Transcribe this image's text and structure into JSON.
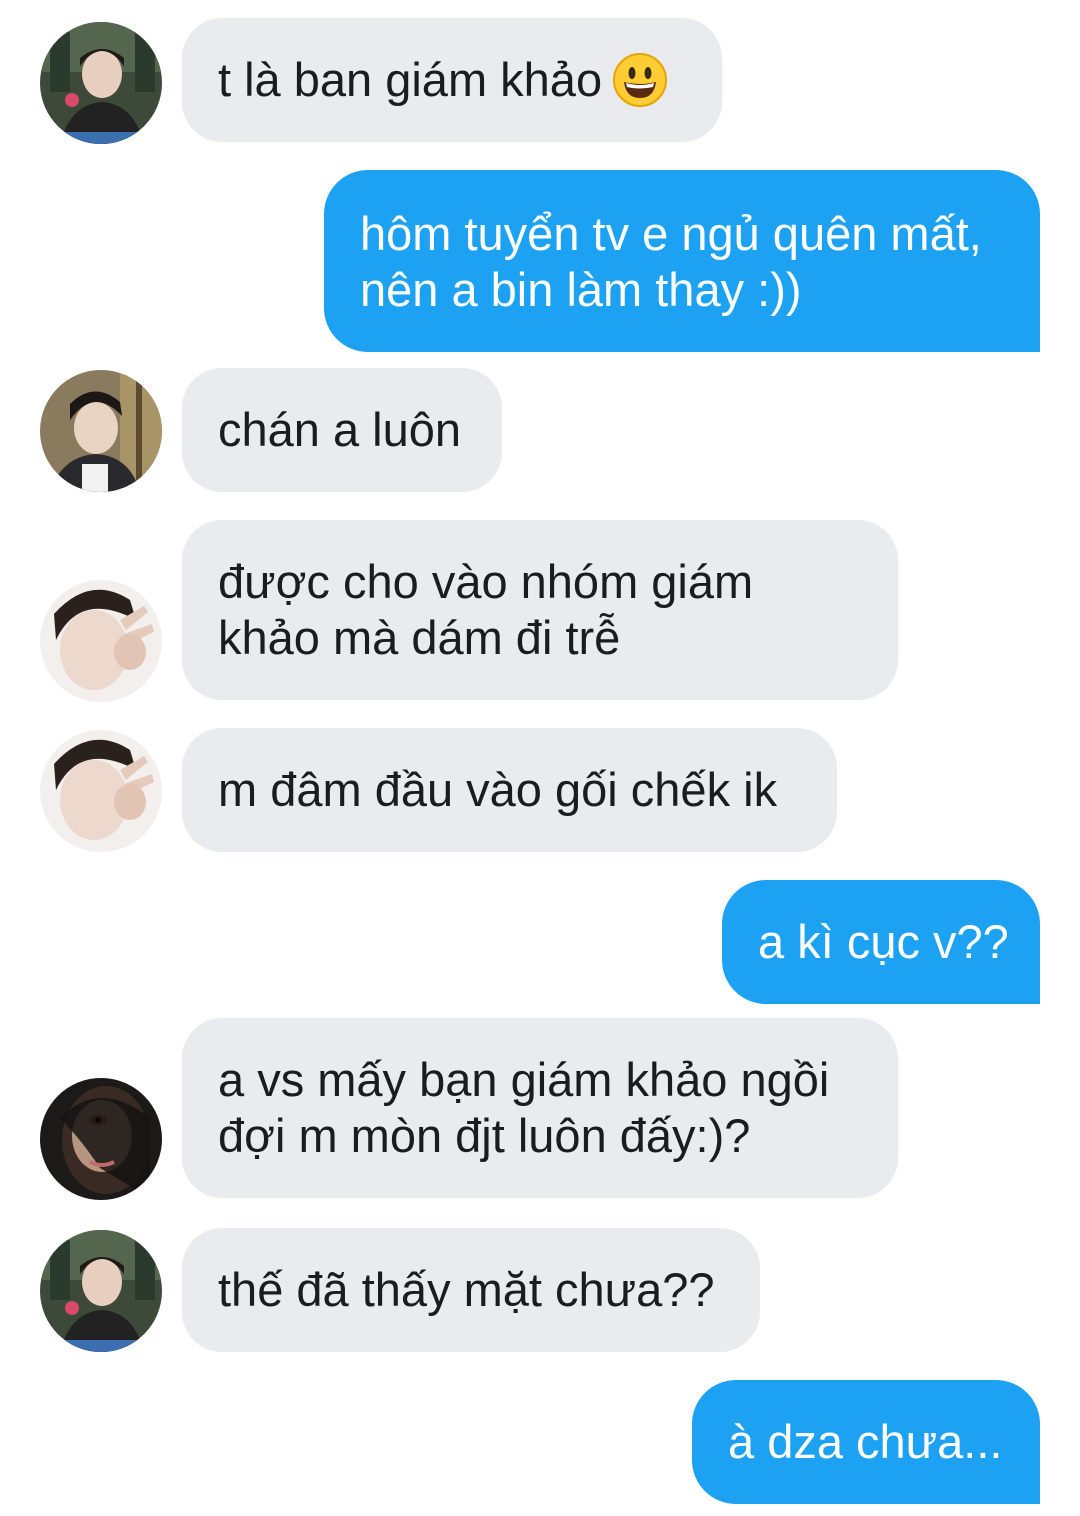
{
  "messages": [
    {
      "side": "in",
      "avatar": "avatar-photo-1",
      "text": "t là ban giám khảo",
      "emoji": "grinning-face-emoji"
    },
    {
      "side": "out",
      "text_lines": [
        "hôm tuyển tv e ngủ quên mất,",
        "nên a bin làm thay :))"
      ]
    },
    {
      "side": "in",
      "avatar": "avatar-photo-2",
      "text": "chán a luôn"
    },
    {
      "side": "in",
      "avatar": "avatar-photo-3",
      "text_lines": [
        "được cho vào nhóm giám",
        "khảo mà dám đi trễ"
      ]
    },
    {
      "side": "in",
      "avatar": "avatar-photo-3",
      "text": "m đâm đầu vào gối chếk ik"
    },
    {
      "side": "out",
      "text": "a kì cục v??"
    },
    {
      "side": "in",
      "avatar": "avatar-photo-4",
      "text_lines": [
        "a vs mấy bạn giám khảo ngồi",
        "đợi m mòn đjt luôn đấy:)?"
      ]
    },
    {
      "side": "in",
      "avatar": "avatar-photo-1",
      "text": "thế đã thấy mặt chưa??"
    },
    {
      "side": "out",
      "text": "à dza chưa..."
    }
  ],
  "colors": {
    "incoming_bubble": "#e9ebef",
    "outgoing_bubble": "#1da1f2",
    "incoming_text": "#1c1c1e",
    "outgoing_text": "#ffffff"
  }
}
